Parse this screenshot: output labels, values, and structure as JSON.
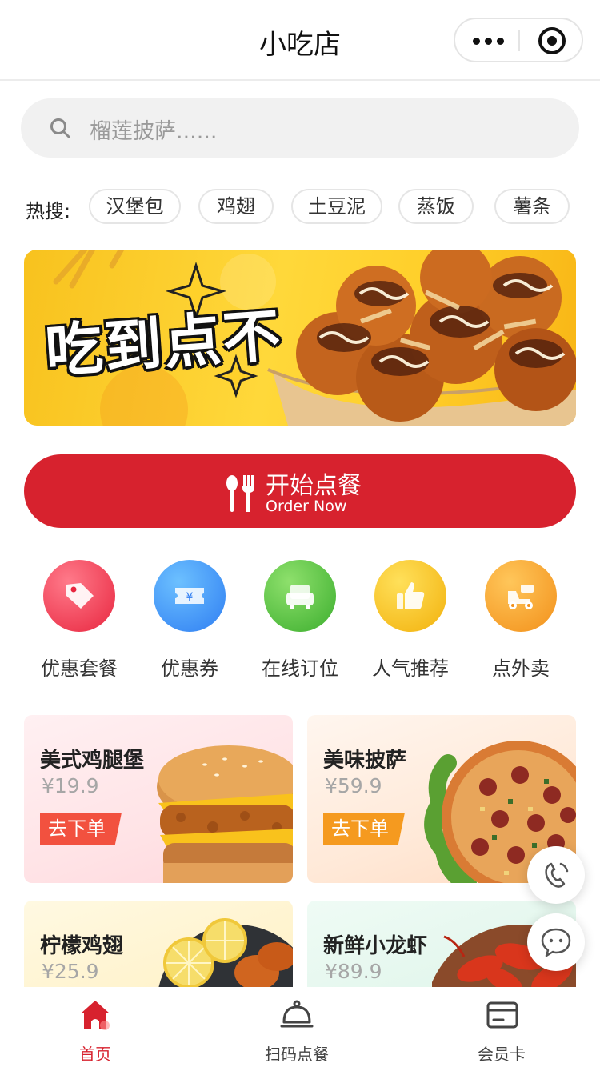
{
  "app": {
    "title": "小吃店",
    "menu_icon": "more-dots-icon",
    "close_icon": "close-circle-icon"
  },
  "search": {
    "placeholder": "榴莲披萨......",
    "icon": "search-icon"
  },
  "hot_search": {
    "label": "热搜:",
    "tags": [
      "汉堡包",
      "鸡翅",
      "土豆泥",
      "蒸饭",
      "薯条"
    ]
  },
  "banner": {
    "text": "吃到点不"
  },
  "order_button": {
    "title": "开始点餐",
    "subtitle": "Order Now",
    "icon": "utensils-icon"
  },
  "features": [
    {
      "label": "优惠套餐",
      "icon": "tag-icon",
      "color": "#ee3a54"
    },
    {
      "label": "优惠券",
      "icon": "coupon-icon",
      "color": "#2f8dfa"
    },
    {
      "label": "在线订位",
      "icon": "sofa-icon",
      "color": "#4fc23c"
    },
    {
      "label": "人气推荐",
      "icon": "thumbs-up-icon",
      "color": "#f6bc12"
    },
    {
      "label": "点外卖",
      "icon": "scooter-icon",
      "color": "#f59a22"
    }
  ],
  "products": [
    {
      "name": "美式鸡腿堡",
      "price": "¥19.9",
      "action": "去下单"
    },
    {
      "name": "美味披萨",
      "price": "¥59.9",
      "action": "去下单"
    },
    {
      "name": "柠檬鸡翅",
      "price": "¥25.9"
    },
    {
      "name": "新鲜小龙虾",
      "price": "¥89.9"
    }
  ],
  "floating": {
    "phone_icon": "phone-icon",
    "chat_icon": "chat-icon"
  },
  "tabbar": {
    "active_color": "#d7222e",
    "tabs": [
      {
        "label": "首页",
        "icon": "home-icon",
        "active": true
      },
      {
        "label": "扫码点餐",
        "icon": "cloche-icon",
        "active": false
      },
      {
        "label": "会员卡",
        "icon": "card-icon",
        "active": false
      }
    ]
  }
}
